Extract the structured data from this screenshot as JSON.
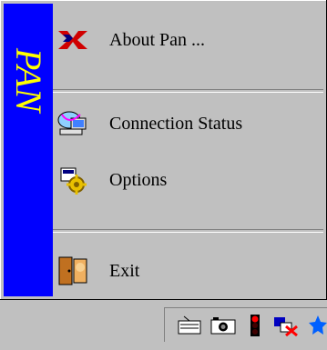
{
  "menu": {
    "brand": "PAN",
    "items": [
      {
        "label": "About Pan ...",
        "icon": "pan-logo-icon"
      },
      {
        "label": "Connection Status",
        "icon": "connection-status-icon"
      },
      {
        "label": "Options",
        "icon": "options-gear-icon"
      },
      {
        "label": "Exit",
        "icon": "exit-door-icon"
      }
    ]
  },
  "taskbar": {
    "tray_icons": [
      "keyboard-icon",
      "camera-icon",
      "traffic-light-icon",
      "network-icon",
      "star-tray-icon"
    ]
  },
  "colors": {
    "menu_bg": "#c0c0c0",
    "brand_strip": "#0000ff",
    "brand_text": "#ffff00"
  }
}
